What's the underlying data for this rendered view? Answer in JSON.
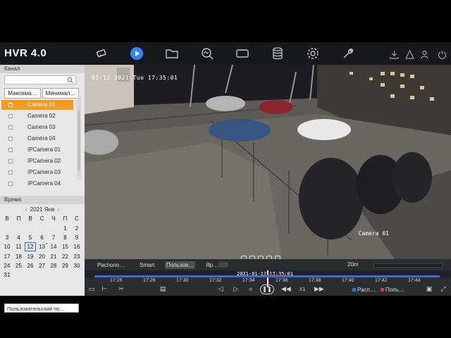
{
  "app": {
    "title": "HVR 4.0"
  },
  "nav": [
    {
      "icon": "camera-icon",
      "active": false
    },
    {
      "icon": "play-icon",
      "active": true
    },
    {
      "icon": "folder-icon",
      "active": false
    },
    {
      "icon": "search-icon",
      "active": false
    },
    {
      "icon": "video-icon",
      "active": false
    },
    {
      "icon": "database-icon",
      "active": false
    },
    {
      "icon": "gear-icon",
      "active": false
    },
    {
      "icon": "wrench-icon",
      "active": false
    }
  ],
  "sidebar": {
    "channel_header": "Канал",
    "maximize_label": "Максима…",
    "minimize_label": "Минимал…",
    "cameras": [
      {
        "label": "Camera 01",
        "selected": true
      },
      {
        "label": "Camera 02",
        "selected": false
      },
      {
        "label": "Camera 03",
        "selected": false
      },
      {
        "label": "Camera 04",
        "selected": false
      },
      {
        "label": "IPCamera 01",
        "selected": false
      },
      {
        "label": "IPCamera 02",
        "selected": false
      },
      {
        "label": "IPCamera 03",
        "selected": false
      },
      {
        "label": "IPCamera 04",
        "selected": false
      }
    ],
    "time_header": "Время",
    "calendar": {
      "month_label": "2021 Янв",
      "weekdays": [
        "В",
        "П",
        "В",
        "С",
        "Ч",
        "П",
        "С"
      ],
      "rows": [
        [
          "",
          "",
          "",
          "",
          "",
          "1",
          "2"
        ],
        [
          "3",
          "4",
          "5",
          "6",
          "7",
          "8",
          "9"
        ],
        [
          "10",
          "11",
          "12",
          "13",
          "14",
          "15",
          "16"
        ],
        [
          "17",
          "18",
          "19",
          "20",
          "21",
          "22",
          "23"
        ],
        [
          "24",
          "25",
          "26",
          "27",
          "28",
          "29",
          "30"
        ],
        [
          "31",
          "",
          "",
          "",
          "",
          "",
          ""
        ]
      ],
      "today": "12"
    },
    "custom_label": "Пользовательский по…"
  },
  "video": {
    "osd_datetime": "01-12-2021 Tue 17:35:01",
    "osd_camera": "Camera 01"
  },
  "playback": {
    "modes": [
      {
        "label": "Располо…",
        "selected": false
      },
      {
        "label": "Smart",
        "selected": false
      },
      {
        "label": "Пользов…",
        "selected": true
      },
      {
        "label": "Яр…",
        "selected": false
      }
    ],
    "timestamp": "2021-01-12 17:35:01",
    "zoom_label": "20m",
    "ticks": [
      "17:26",
      "17:28",
      "17:30",
      "17:32",
      "17:34",
      "17:36",
      "17:38",
      "17:40",
      "17:42",
      "17:44"
    ],
    "speed_label": "X1",
    "legend": [
      {
        "label": "Расп…",
        "color": "#2f6fe0"
      },
      {
        "label": "Поль…",
        "color": "#e23a2f"
      }
    ]
  },
  "colors": {
    "accent": "#f29a1f",
    "active_nav": "#2f86ff",
    "timeline": "#2f6fe0"
  }
}
